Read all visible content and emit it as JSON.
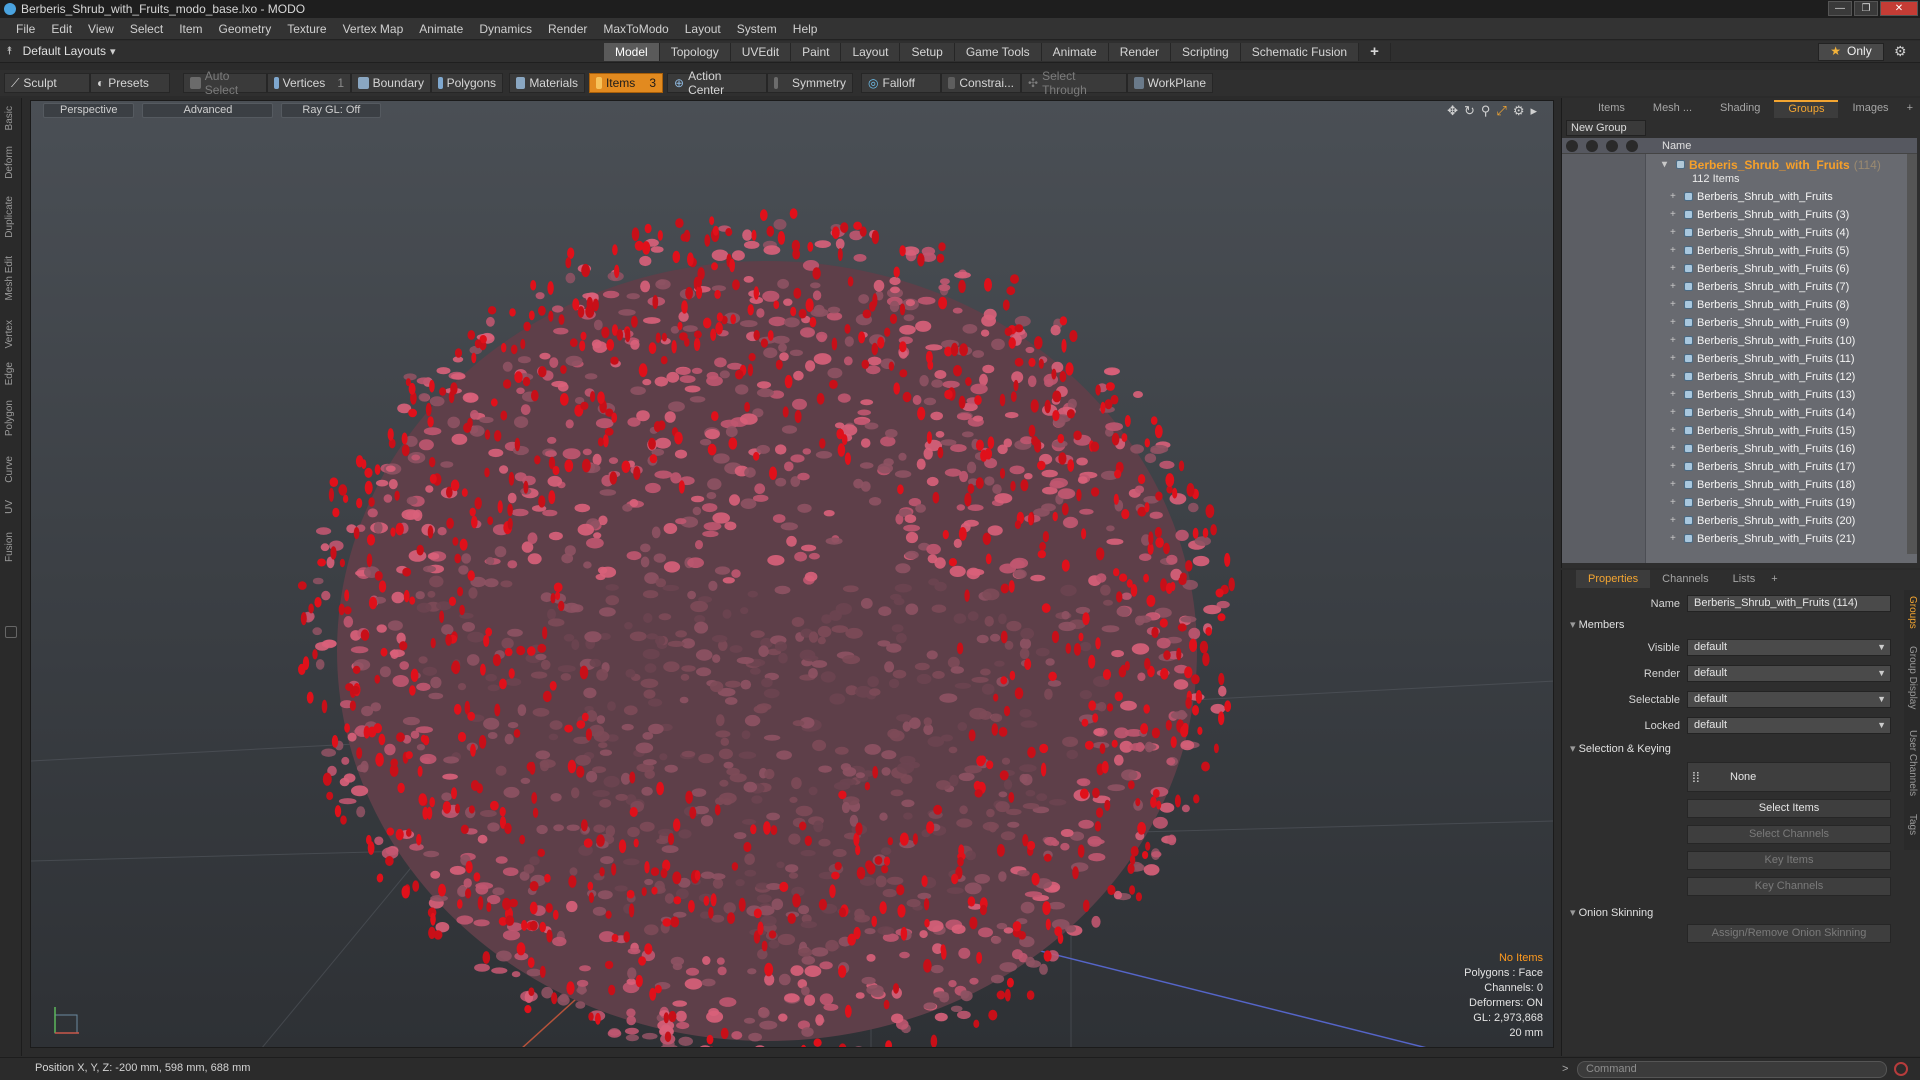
{
  "window": {
    "title": "Berberis_Shrub_with_Fruits_modo_base.lxo - MODO",
    "controls": [
      "—",
      "❐",
      "✕"
    ]
  },
  "menu": [
    "File",
    "Edit",
    "View",
    "Select",
    "Item",
    "Geometry",
    "Texture",
    "Vertex Map",
    "Animate",
    "Dynamics",
    "Render",
    "MaxToModo",
    "Layout",
    "System",
    "Help"
  ],
  "layout_bar": {
    "selector": "Default Layouts",
    "tabs": [
      "Model",
      "Topology",
      "UVEdit",
      "Paint",
      "Layout",
      "Setup",
      "Game Tools",
      "Animate",
      "Render",
      "Scripting",
      "Schematic Fusion"
    ],
    "active_tab": "Model",
    "add_tab": "+",
    "only_label": "Only"
  },
  "toolbar": {
    "sculpt": "Sculpt",
    "presets": "Presets",
    "auto_select": "Auto Select",
    "vertices": "Vertices",
    "vertices_count": "1",
    "boundary": "Boundary",
    "polygons": "Polygons",
    "materials": "Materials",
    "items": "Items",
    "items_count": "3",
    "action_center": "Action Center",
    "symmetry": "Symmetry",
    "falloff": "Falloff",
    "constraints": "Constrai...",
    "select_through": "Select Through",
    "workplane": "WorkPlane"
  },
  "left_tabs": [
    "Basic",
    "Deform",
    "Duplicate",
    "Mesh Edit",
    "Vertex",
    "Edge",
    "Polygon",
    "Curve",
    "UV",
    "Fusion"
  ],
  "viewport": {
    "view": "Perspective",
    "mode": "Advanced",
    "raygl": "Ray GL: Off",
    "info": {
      "items": "No Items",
      "polygons": "Polygons : Face",
      "channels": "Channels: 0",
      "deformers": "Deformers: ON",
      "gl": "GL: 2,973,868",
      "scale": "20 mm"
    }
  },
  "status": {
    "position": "Position X, Y, Z:  -200 mm, 598 mm, 688 mm",
    "command_placeholder": "Command"
  },
  "groups_panel": {
    "tabs": [
      "Items",
      "Mesh ...",
      "Shading",
      "Groups",
      "Images"
    ],
    "active_tab": "Groups",
    "add_tab": "+",
    "new_group": "New Group",
    "column_name": "Name",
    "group_name": "Berberis_Shrub_with_Fruits",
    "group_count": "(114)",
    "group_sub": "112 Items",
    "rows": [
      "Berberis_Shrub_with_Fruits",
      "Berberis_Shrub_with_Fruits (3)",
      "Berberis_Shrub_with_Fruits (4)",
      "Berberis_Shrub_with_Fruits (5)",
      "Berberis_Shrub_with_Fruits (6)",
      "Berberis_Shrub_with_Fruits (7)",
      "Berberis_Shrub_with_Fruits (8)",
      "Berberis_Shrub_with_Fruits (9)",
      "Berberis_Shrub_with_Fruits (10)",
      "Berberis_Shrub_with_Fruits (11)",
      "Berberis_Shrub_with_Fruits (12)",
      "Berberis_Shrub_with_Fruits (13)",
      "Berberis_Shrub_with_Fruits (14)",
      "Berberis_Shrub_with_Fruits (15)",
      "Berberis_Shrub_with_Fruits (16)",
      "Berberis_Shrub_with_Fruits (17)",
      "Berberis_Shrub_with_Fruits (18)",
      "Berberis_Shrub_with_Fruits (19)",
      "Berberis_Shrub_with_Fruits (20)",
      "Berberis_Shrub_with_Fruits (21)"
    ]
  },
  "properties": {
    "tabs": [
      "Properties",
      "Channels",
      "Lists"
    ],
    "active_tab": "Properties",
    "add_tab": "+",
    "name_label": "Name",
    "name_value": "Berberis_Shrub_with_Fruits (114)",
    "members_section": "Members",
    "visible_label": "Visible",
    "visible_value": "default",
    "render_label": "Render",
    "render_value": "default",
    "selectable_label": "Selectable",
    "selectable_value": "default",
    "locked_label": "Locked",
    "locked_value": "default",
    "selection_section": "Selection & Keying",
    "none_btn": "None",
    "select_items": "Select Items",
    "select_channels": "Select Channels",
    "key_items": "Key Items",
    "key_channels": "Key Channels",
    "onion_section": "Onion Skinning",
    "onion_btn": "Assign/Remove Onion Skinning",
    "side_tabs": [
      "Groups",
      "Group Display",
      "User Channels",
      "Tags"
    ]
  },
  "colors": {
    "accent": "#f3a531",
    "items_active": "#e28a1f",
    "berry": "#e0101a",
    "leaf_pink": "#d9607a",
    "leaf_dark": "#6b4450"
  }
}
